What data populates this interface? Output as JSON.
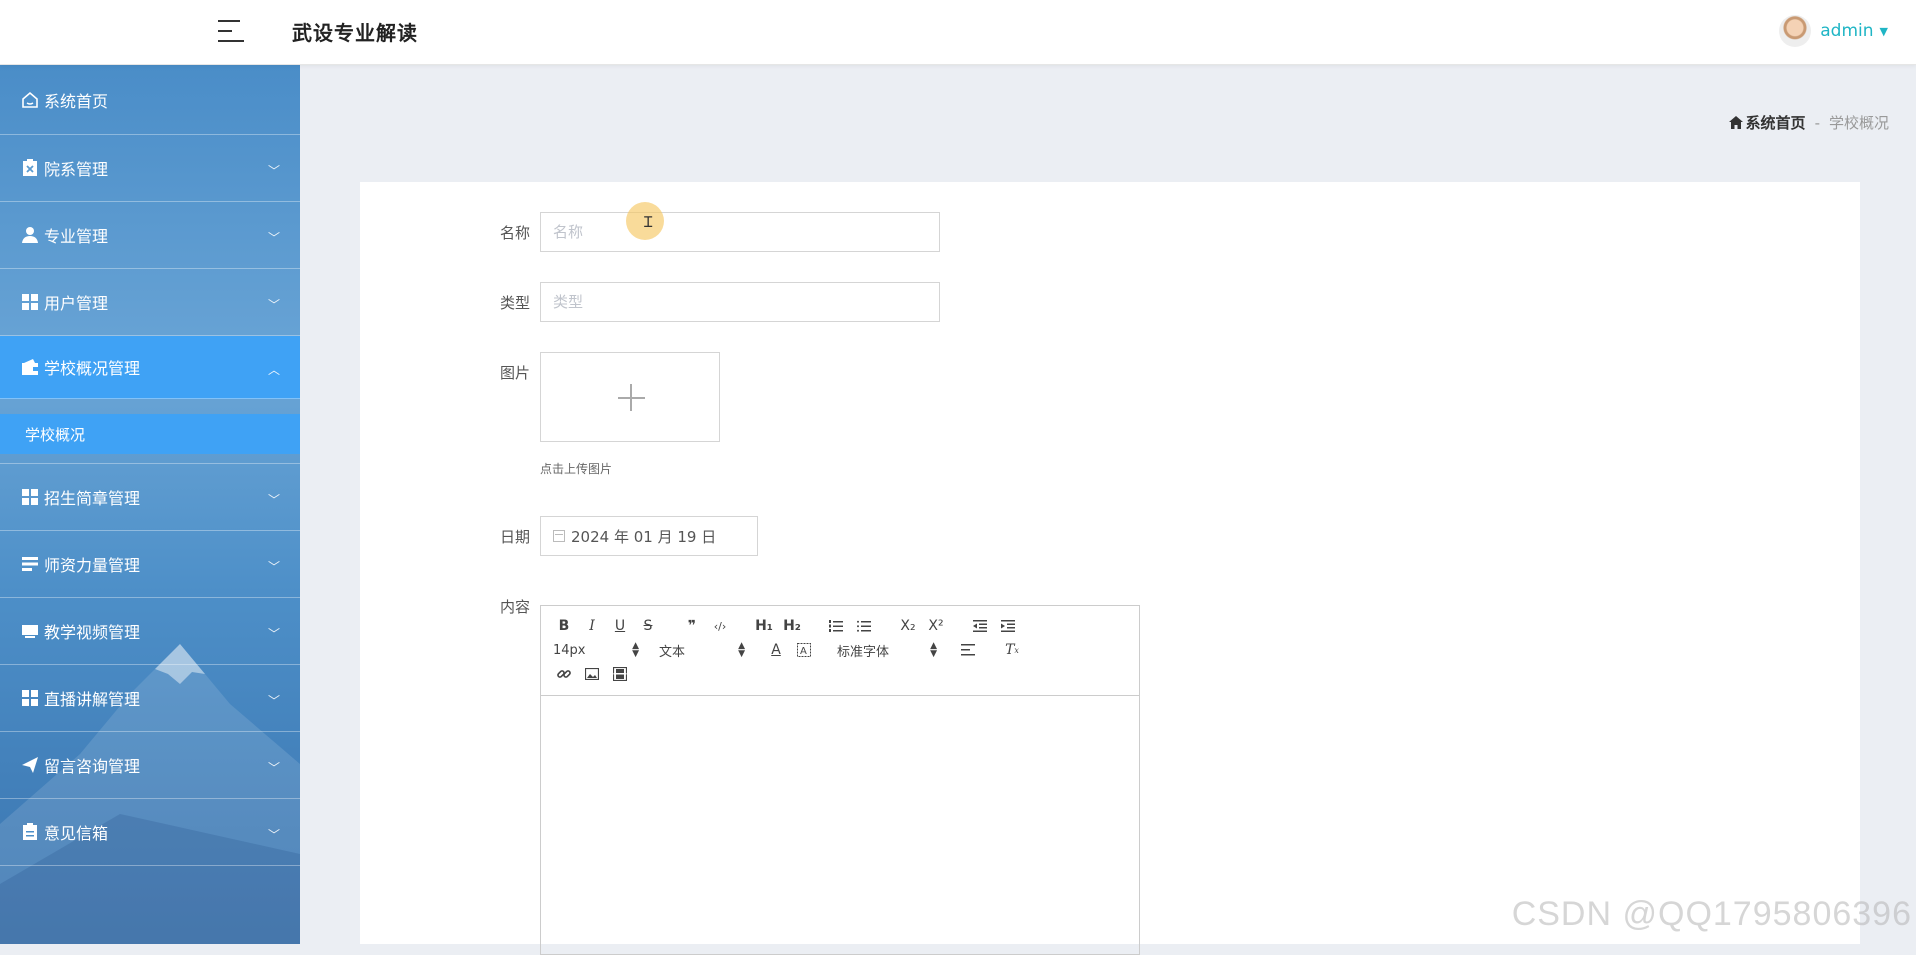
{
  "header": {
    "title": "武设专业解读",
    "username": "admin"
  },
  "sidebar": {
    "items": [
      {
        "label": "系统首页",
        "icon": "home-icon"
      },
      {
        "label": "院系管理",
        "icon": "clipboard-x-icon"
      },
      {
        "label": "专业管理",
        "icon": "user-icon"
      },
      {
        "label": "用户管理",
        "icon": "grid-icon"
      },
      {
        "label": "学校概况管理",
        "icon": "wallet-icon"
      },
      {
        "label": "招生简章管理",
        "icon": "grid-icon"
      },
      {
        "label": "师资力量管理",
        "icon": "server-icon"
      },
      {
        "label": "教学视频管理",
        "icon": "inbox-icon"
      },
      {
        "label": "直播讲解管理",
        "icon": "grid-icon"
      },
      {
        "label": "留言咨询管理",
        "icon": "paper-plane-icon"
      },
      {
        "label": "意见信箱",
        "icon": "clipboard-icon"
      }
    ],
    "active_sub": "学校概况"
  },
  "breadcrumb": {
    "home": "系统首页",
    "separator": "-",
    "current": "学校概况"
  },
  "form": {
    "name_label": "名称",
    "name_placeholder": "名称",
    "type_label": "类型",
    "type_placeholder": "类型",
    "image_label": "图片",
    "upload_hint": "点击上传图片",
    "date_label": "日期",
    "date_value": "2024 年 01 月 19 日",
    "content_label": "内容"
  },
  "editor": {
    "font_size": "14px",
    "paragraph": "文本",
    "font_family": "标准字体",
    "buttons": [
      "B",
      "I",
      "U",
      "S",
      "❞",
      "‹/›",
      "H₁",
      "H₂",
      "ol",
      "ul",
      "X₂",
      "X²",
      "outdent",
      "indent"
    ]
  },
  "watermark": "CSDN @QQ1795806396",
  "colors": {
    "accent": "#1fb5c5",
    "active_menu": "#3fa2f5",
    "sidebar": "#5a9bd0"
  }
}
